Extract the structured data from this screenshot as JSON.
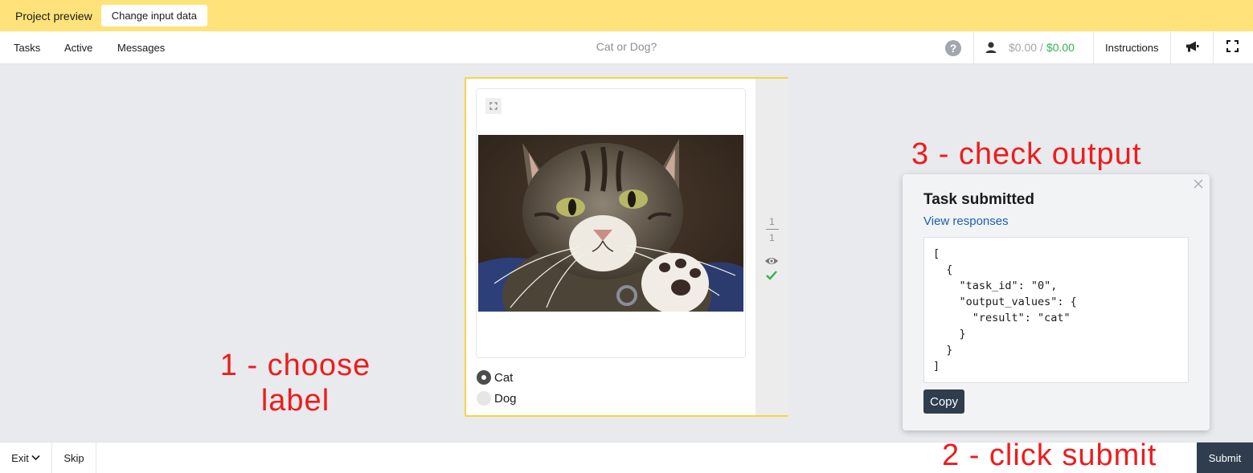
{
  "preview_bar": {
    "title": "Project preview",
    "change_button": "Change input data"
  },
  "nav": {
    "links": [
      "Tasks",
      "Active",
      "Messages"
    ],
    "title": "Cat or Dog?",
    "help_icon": "help-circle-icon",
    "user_icon": "user-icon",
    "earnings_pending": "$0.00",
    "earnings_separator": "/",
    "earnings_total": "$0.00",
    "instructions": "Instructions",
    "megaphone_icon": "megaphone-icon",
    "fullscreen_icon": "fullscreen-icon"
  },
  "task": {
    "options": [
      {
        "label": "Cat",
        "selected": true
      },
      {
        "label": "Dog",
        "selected": false
      }
    ],
    "counter_current": "1",
    "counter_total": "1",
    "eye_icon": "eye-icon",
    "check_icon": "check-icon"
  },
  "annotations": {
    "step1_line1": "1 - choose",
    "step1_line2": "label",
    "step2": "2 - click submit",
    "step3": "3 - check output"
  },
  "panel": {
    "title": "Task submitted",
    "link": "View responses",
    "json_lines": [
      "[",
      "  {",
      "    \"task_id\": \"0\",",
      "    \"output_values\": {",
      "      \"result\": \"cat\"",
      "    }",
      "  }",
      "]"
    ],
    "copy_button": "Copy"
  },
  "bottom": {
    "exit": "Exit",
    "skip": "Skip",
    "submit": "Submit"
  },
  "colors": {
    "preview_bar": "#ffe37a",
    "card_border": "#f5d547",
    "annotation": "#ee1c1c",
    "earnings_total": "#2fb44e",
    "dark_button": "#2f3d4e",
    "link": "#1a5fb4"
  }
}
